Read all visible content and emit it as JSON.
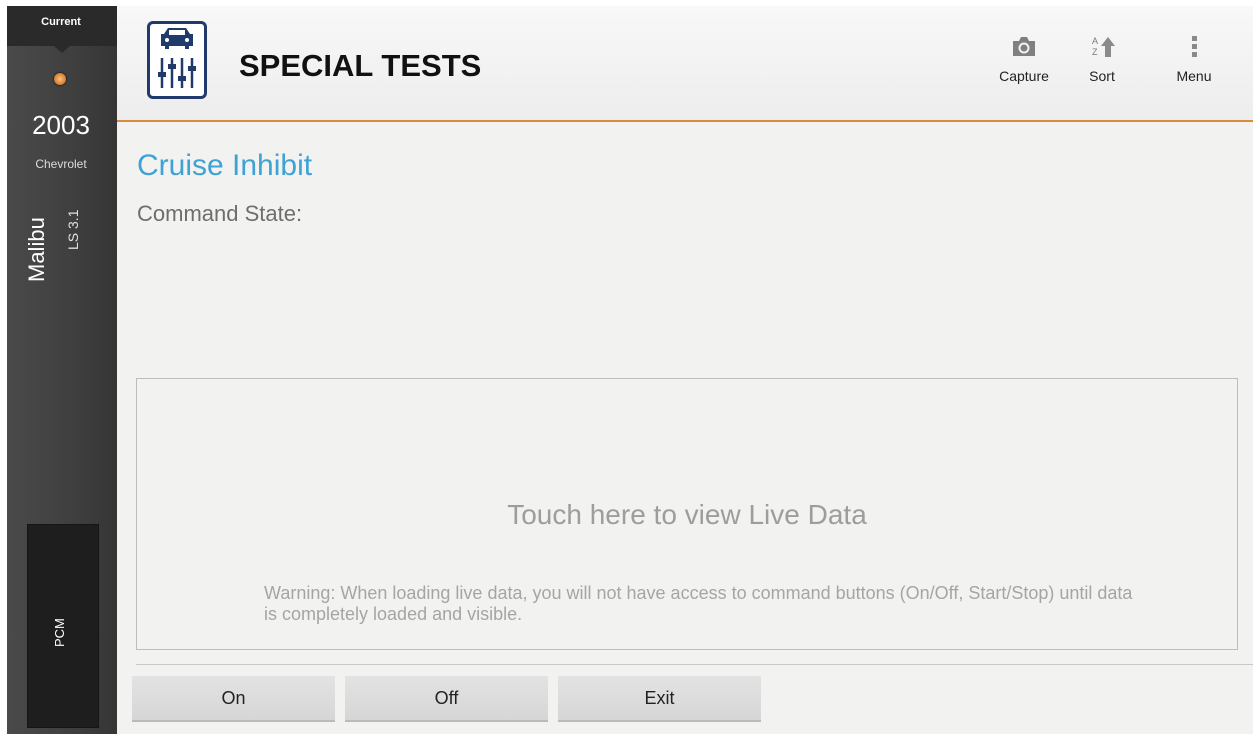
{
  "sidebar": {
    "current_label": "Current",
    "year": "2003",
    "make": "Chevrolet",
    "model": "Malibu",
    "trim": "LS 3.1",
    "module": "PCM",
    "status_color": "#e08a3a"
  },
  "header": {
    "title": "SPECIAL TESTS",
    "icon": "car-test-icon",
    "actions": [
      {
        "label": "Capture",
        "icon": "camera-icon"
      },
      {
        "label": "Sort",
        "icon": "sort-az-icon"
      },
      {
        "label": "Menu",
        "icon": "overflow-menu-icon"
      }
    ],
    "accent_color": "#d98c3c"
  },
  "main": {
    "test_name": "Cruise Inhibit",
    "command_state_label": "Command State:",
    "live_data": {
      "title": "Touch here to view Live Data",
      "warning": "Warning: When loading live data, you will not have access to command buttons (On/Off, Start/Stop) until data is completely loaded and visible."
    },
    "buttons": [
      {
        "label": "On"
      },
      {
        "label": "Off"
      },
      {
        "label": "Exit"
      }
    ]
  }
}
